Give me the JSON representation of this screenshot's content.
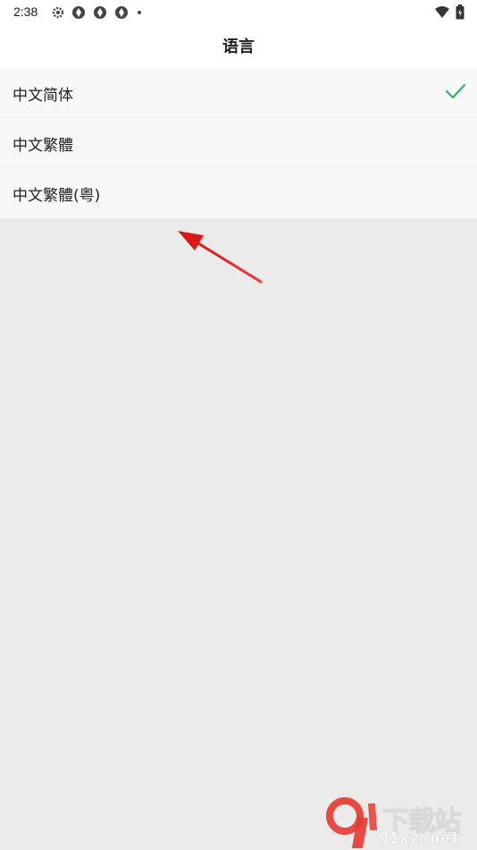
{
  "status_bar": {
    "time": "2:38",
    "left_icons": [
      "settings-gear-icon",
      "aperture-icon",
      "aperture-icon",
      "aperture-icon",
      "dot-icon"
    ],
    "right_icons": [
      "wifi-icon",
      "battery-icon"
    ]
  },
  "header": {
    "title": "语言"
  },
  "languages": [
    {
      "label": "中文简体",
      "selected": true
    },
    {
      "label": "中文繁體",
      "selected": false
    },
    {
      "label": "中文繁體(粤)",
      "selected": false
    }
  ],
  "colors": {
    "check": "#2bb55d",
    "annotation_arrow": "#e02020",
    "background": "#ebebeb",
    "list_item": "#f8f8f8",
    "watermark_red": "#e8382f"
  },
  "watermark": {
    "logo_text": "9",
    "text_cn": "下载站",
    "text_url": "91xz.net"
  }
}
